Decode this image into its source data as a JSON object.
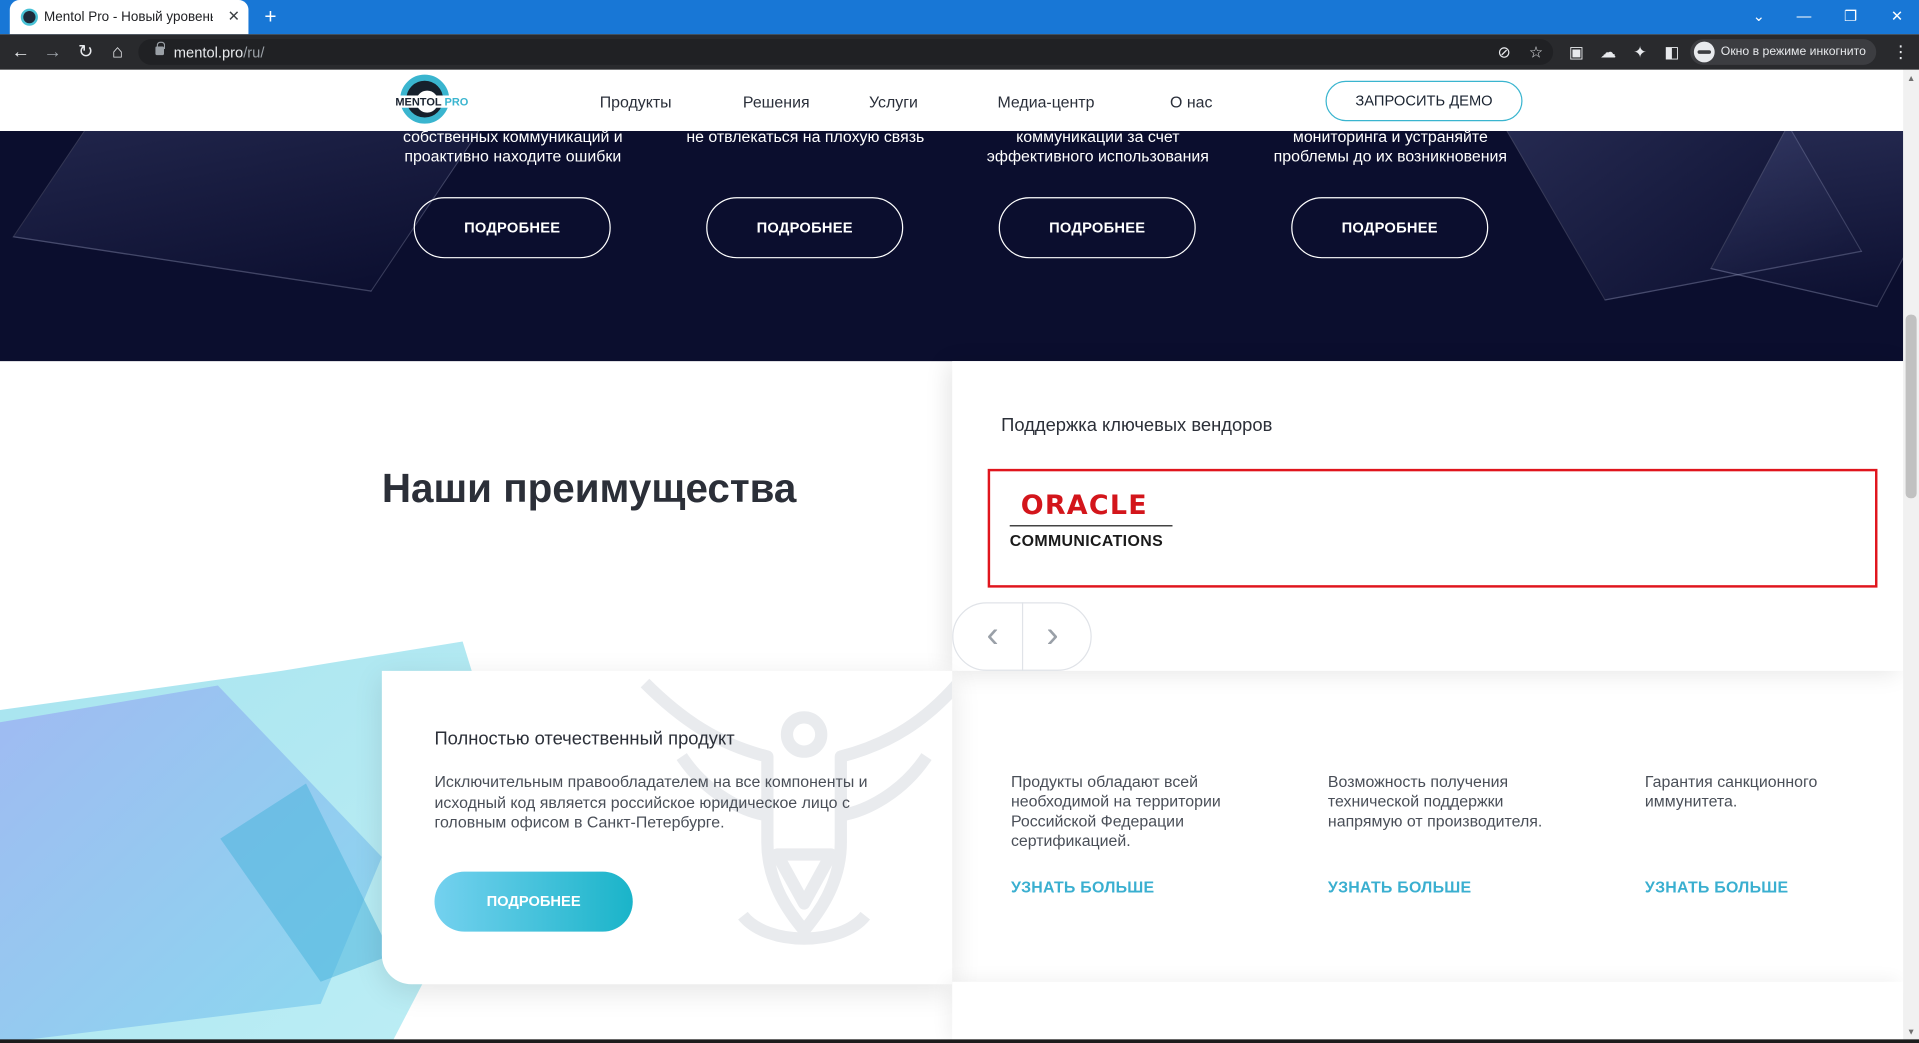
{
  "browser": {
    "tab_title": "Mentol Pro - Новый уровень на",
    "url_host": "mentol.pro",
    "url_path": "/ru/",
    "incognito_label": "Окно в режиме инкогнито"
  },
  "header": {
    "logo_main": "MENTOL",
    "logo_accent": "PRO",
    "nav": [
      "Продукты",
      "Решения",
      "Услуги",
      "Медиа-центр",
      "О нас"
    ],
    "demo_button": "ЗАПРОСИТЬ ДЕМО"
  },
  "hero": {
    "columns": [
      {
        "text": "собственных коммуникаций и проактивно находите ошибки",
        "button": "ПОДРОБНЕЕ"
      },
      {
        "text": "не отвлекаться на плохую связь",
        "button": "ПОДРОБНЕЕ"
      },
      {
        "text": "коммуникации за счет эффективного использования",
        "button": "ПОДРОБНЕЕ"
      },
      {
        "text": "мониторинга и устраняйте проблемы до их возникновения",
        "button": "ПОДРОБНЕЕ"
      }
    ]
  },
  "advantages": {
    "title": "Наши преимущества"
  },
  "vendors": {
    "title": "Поддержка ключевых вендоров",
    "logo_word": "ORACLE",
    "logo_sub": "COMMUNICATIONS"
  },
  "product_card": {
    "title": "Полностью отечественный продукт",
    "text": "Исключительным правообладателем на все компоненты и исходный код является российское юридическое лицо с головным офисом в Санкт-Петербурге.",
    "button": "ПОДРОБНЕЕ"
  },
  "features": [
    {
      "text": "Продукты обладают всей необходимой на территории Российской Федерации сертификацией.",
      "link": "УЗНАТЬ БОЛЬШЕ"
    },
    {
      "text": "Возможность получения технической поддержки напрямую от производителя.",
      "link": "УЗНАТЬ БОЛЬШЕ"
    },
    {
      "text": "Гарантия санкционного иммунитета.",
      "link": "УЗНАТЬ БОЛЬШЕ"
    }
  ],
  "colors": {
    "accent": "#3ab5cf",
    "hero_bg": "#0b0e2e",
    "oracle_red": "#d3151b",
    "highlight_frame": "#e0151d"
  }
}
